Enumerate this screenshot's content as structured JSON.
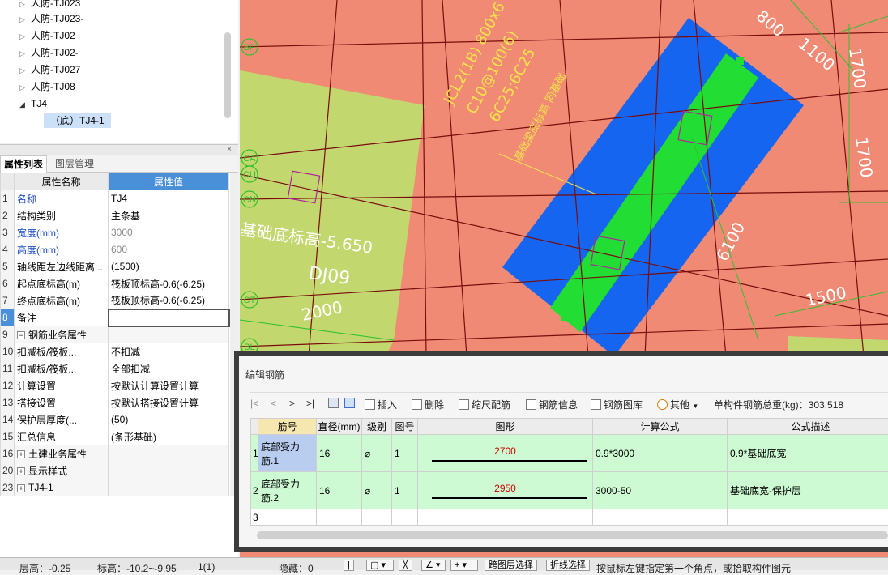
{
  "tree": {
    "items": [
      {
        "label": "人防-TJ023",
        "expanded": false
      },
      {
        "label": "人防-TJ023-",
        "expanded": false
      },
      {
        "label": "人防-TJ02",
        "expanded": false
      },
      {
        "label": "人防-TJ02-",
        "expanded": false
      },
      {
        "label": "人防-TJ027",
        "expanded": false
      },
      {
        "label": "人防-TJ08",
        "expanded": false
      },
      {
        "label": "TJ4",
        "expanded": true
      },
      {
        "label": "（底）TJ4-1",
        "selected": true
      }
    ]
  },
  "prop_panel": {
    "close": "×",
    "tabs": [
      "属性列表",
      "图层管理"
    ],
    "headers": {
      "name": "属性名称",
      "value": "属性值"
    },
    "rows": [
      {
        "n": "1",
        "name": "名称",
        "value": "TJ4"
      },
      {
        "n": "2",
        "name": "结构类别",
        "value": "主条基"
      },
      {
        "n": "3",
        "name": "宽度(mm)",
        "value": "3000"
      },
      {
        "n": "4",
        "name": "高度(mm)",
        "value": "600"
      },
      {
        "n": "5",
        "name": "轴线距左边线距离...",
        "value": "(1500)"
      },
      {
        "n": "6",
        "name": "起点底标高(m)",
        "value": "筏板顶标高-0.6(-6.25)"
      },
      {
        "n": "7",
        "name": "终点底标高(m)",
        "value": "筏板顶标高-0.6(-6.25)"
      },
      {
        "n": "8",
        "name": "备注",
        "value": ""
      },
      {
        "n": "9",
        "name": "钢筋业务属性",
        "value": ""
      },
      {
        "n": "10",
        "name": "扣减板/筏板...",
        "value": "不扣减"
      },
      {
        "n": "11",
        "name": "扣减板/筏板...",
        "value": "全部扣减"
      },
      {
        "n": "12",
        "name": "计算设置",
        "value": "按默认计算设置计算"
      },
      {
        "n": "13",
        "name": "搭接设置",
        "value": "按默认搭接设置计算"
      },
      {
        "n": "14",
        "name": "保护层厚度(...",
        "value": "(50)"
      },
      {
        "n": "15",
        "name": "汇总信息",
        "value": "(条形基础)"
      },
      {
        "n": "16",
        "name": "土建业务属性",
        "value": ""
      },
      {
        "n": "20",
        "name": "显示样式",
        "value": ""
      },
      {
        "n": "23",
        "name": "TJ4-1",
        "value": ""
      }
    ]
  },
  "canvas": {
    "axis_labels": [
      "BP",
      "CA",
      "CU",
      "CN",
      "CT",
      "BL"
    ],
    "dims": [
      "800",
      "1100",
      "1700",
      "1700",
      "6100",
      "1500",
      "2000"
    ],
    "texts": {
      "elev": "基础底标高-5.650",
      "dj": "DJ09",
      "note1": "JCL2(1B) 800x6",
      "note2": "C10@100(6)",
      "note3": "6C25;6C25",
      "note4": "基础梁底标高 同基础"
    },
    "colors": {
      "bg": "#f08a74",
      "slab": "#c3d76f",
      "blue": "#1565f0",
      "green": "#22dd33",
      "axis": "#7a0c0c",
      "dim": "#2fc12f",
      "text": "#f2e24a"
    }
  },
  "dialog": {
    "title": "编辑钢筋",
    "toolbar": {
      "first": "|<",
      "prev": "<",
      "next": ">",
      "last": ">|",
      "insert": "插入",
      "delete": "删除",
      "scale": "缩尺配筋",
      "info": "钢筋信息",
      "library": "钢筋图库",
      "other": "其他",
      "total": "单构件钢筋总重(kg)：303.518"
    },
    "columns": [
      "筋号",
      "直径(mm)",
      "级别",
      "图号",
      "图形",
      "计算公式",
      "公式描述"
    ],
    "rows": [
      {
        "n": "1",
        "name": "底部受力筋.1",
        "dia": "16",
        "grade": "⌀",
        "fig": "1",
        "len": "2700",
        "formula": "0.9*3000",
        "desc": "0.9*基础底宽"
      },
      {
        "n": "2",
        "name": "底部受力筋.2",
        "dia": "16",
        "grade": "⌀",
        "fig": "1",
        "len": "2950",
        "formula": "3000-50",
        "desc": "基础底宽-保护层"
      },
      {
        "n": "3",
        "name": "",
        "dia": "",
        "grade": "",
        "fig": "",
        "len": "",
        "formula": "",
        "desc": ""
      }
    ]
  },
  "status": {
    "floor": "层高：-0.25",
    "elev": "标高：-10.2~-9.95",
    "count": "1(1)",
    "hidden": "隐藏：0",
    "btn_layer": "跨图层选择",
    "btn_poly": "折线选择",
    "hint": "按鼠标左键指定第一个角点，或拾取构件图元"
  }
}
